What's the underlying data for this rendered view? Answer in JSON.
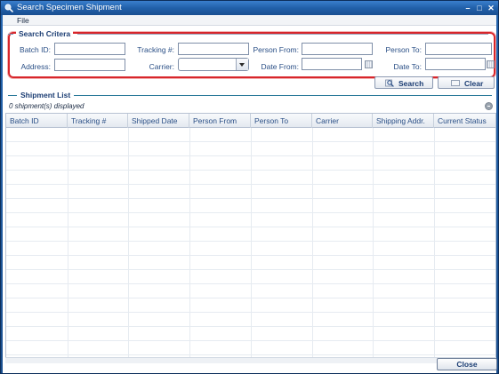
{
  "window": {
    "title": "Search Specimen Shipment",
    "controls": {
      "minimize": "–",
      "maximize": "□",
      "close": "✕"
    }
  },
  "menu": {
    "items": [
      "File"
    ]
  },
  "search_criteria": {
    "legend": "Search Critera",
    "fields": {
      "batch_id": {
        "label": "Batch ID:",
        "value": ""
      },
      "tracking": {
        "label": "Tracking #:",
        "value": ""
      },
      "person_from": {
        "label": "Person From:",
        "value": ""
      },
      "person_to": {
        "label": "Person To:",
        "value": ""
      },
      "address": {
        "label": "Address:",
        "value": ""
      },
      "carrier": {
        "label": "Carrier:",
        "value": ""
      },
      "date_from": {
        "label": "Date From:",
        "value": ""
      },
      "date_to": {
        "label": "Date To:",
        "value": ""
      }
    },
    "buttons": {
      "search": "Search",
      "clear": "Clear"
    }
  },
  "shipment_list": {
    "legend": "Shipment List",
    "count_text": "0 shipment(s) displayed",
    "columns": [
      "Batch ID",
      "Tracking #",
      "Shipped Date",
      "Person From",
      "Person To",
      "Carrier",
      "Shipping Addr.",
      "Current Status"
    ],
    "rows": []
  },
  "footer": {
    "close_label": "Close"
  },
  "colors": {
    "highlight": "#d8262b",
    "title_bar": "#2160aa",
    "label": "#2a4f86"
  }
}
